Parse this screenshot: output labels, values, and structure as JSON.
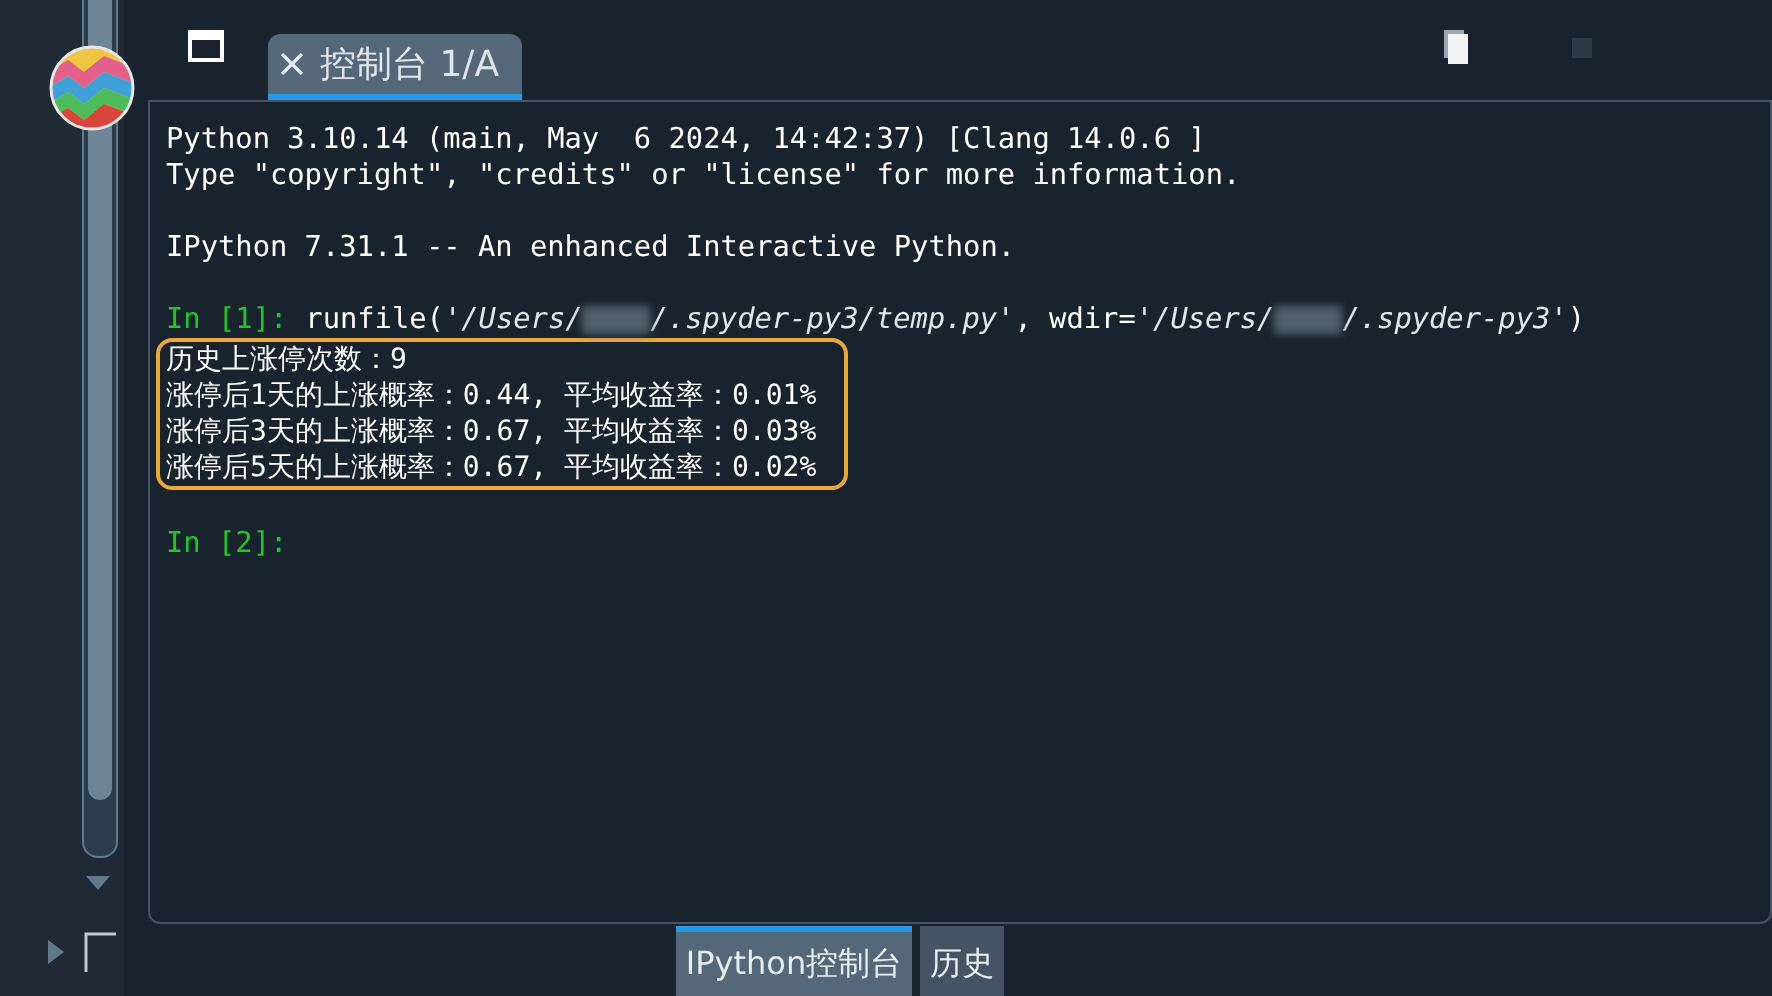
{
  "console_tab": {
    "label": "控制台 1/A",
    "selected": true
  },
  "console": {
    "banner": [
      "Python 3.10.14 (main, May  6 2024, 14:42:37) [Clang 14.0.6 ]",
      "Type \"copyright\", \"credits\" or \"license\" for more information."
    ],
    "ipython_line": "IPython 7.31.1 -- An enhanced Interactive Python.",
    "cells": [
      {
        "prompt": "In [1]:",
        "code": [
          {
            "kind": "plain",
            "text": "runfile("
          },
          {
            "kind": "string",
            "text": "'/Users/"
          },
          {
            "kind": "redacted"
          },
          {
            "kind": "string",
            "text": "/.spyder-py3/temp.py'"
          },
          {
            "kind": "plain",
            "text": ", wdir="
          },
          {
            "kind": "string",
            "text": "'/Users/"
          },
          {
            "kind": "redacted"
          },
          {
            "kind": "string",
            "text": "/.spyder-py3'"
          },
          {
            "kind": "plain",
            "text": ")"
          }
        ],
        "output_highlighted": true,
        "output": [
          "历史上涨停次数：9",
          "涨停后1天的上涨概率：0.44, 平均收益率：0.01%",
          "涨停后3天的上涨概率：0.67, 平均收益率：0.03%",
          "涨停后5天的上涨概率：0.67, 平均收益率：0.02%"
        ]
      },
      {
        "prompt": "In [2]:"
      }
    ]
  },
  "bottom_tabs": [
    {
      "label": "IPython控制台",
      "selected": true
    },
    {
      "label": "历史",
      "selected": false
    }
  ]
}
